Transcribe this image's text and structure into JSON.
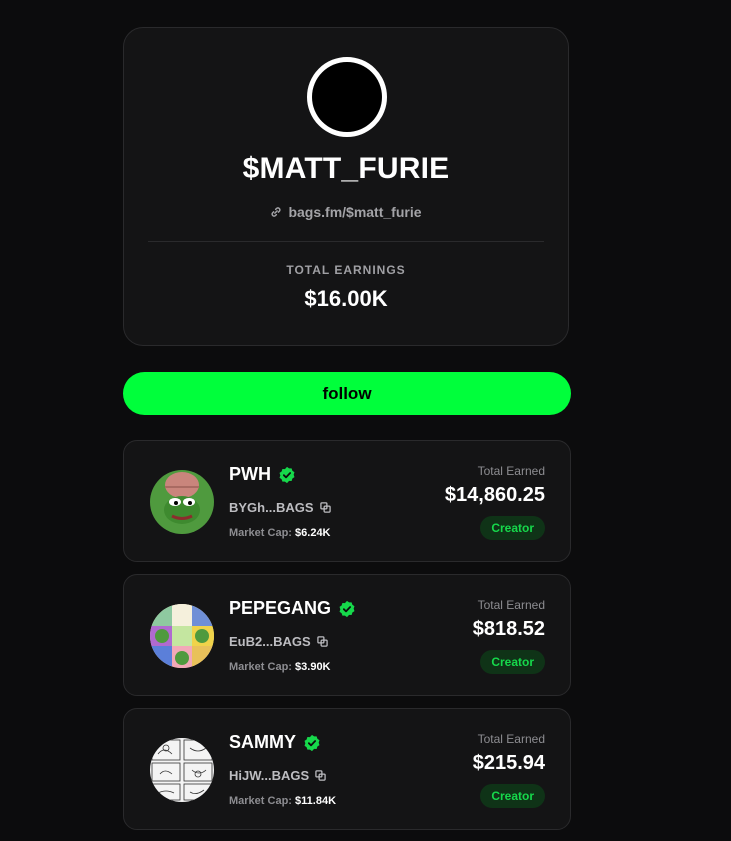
{
  "profile": {
    "name": "$MATT_FURIE",
    "link": "bags.fm/$matt_furie",
    "earnings_label": "TOTAL EARNINGS",
    "earnings_value": "$16.00K"
  },
  "follow_label": "follow",
  "tokens": [
    {
      "name": "PWH",
      "address": "BYGh...BAGS",
      "mcap_label": "Market Cap:",
      "mcap_value": "$6.24K",
      "earned_label": "Total Earned",
      "earned_value": "$14,860.25",
      "badge": "Creator"
    },
    {
      "name": "PEPEGANG",
      "address": "EuB2...BAGS",
      "mcap_label": "Market Cap:",
      "mcap_value": "$3.90K",
      "earned_label": "Total Earned",
      "earned_value": "$818.52",
      "badge": "Creator"
    },
    {
      "name": "SAMMY",
      "address": "HiJW...BAGS",
      "mcap_label": "Market Cap:",
      "mcap_value": "$11.84K",
      "earned_label": "Total Earned",
      "earned_value": "$215.94",
      "badge": "Creator"
    }
  ],
  "colors": {
    "accent": "#00ff3b",
    "verified": "#16d84b",
    "badge_bg": "#0f3317"
  }
}
